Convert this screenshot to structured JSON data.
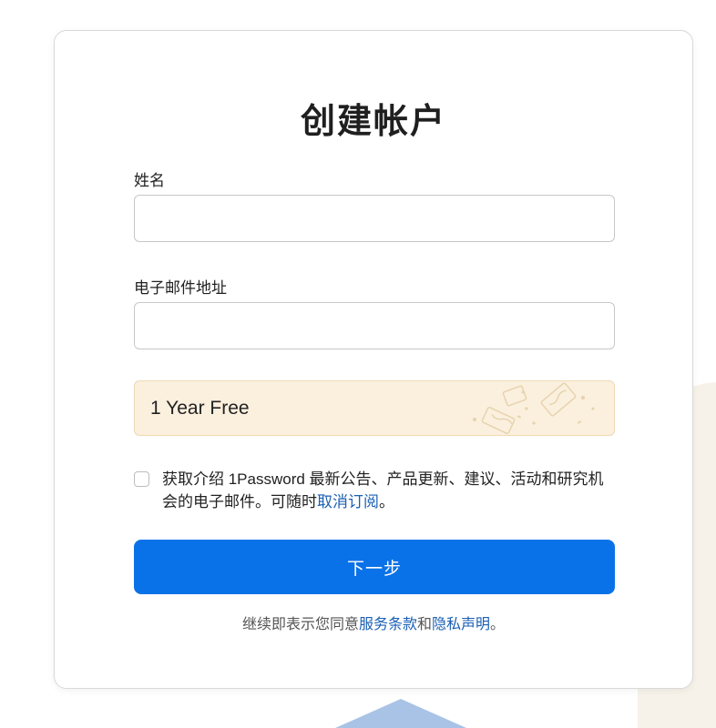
{
  "form": {
    "title": "创建帐户",
    "name_label": "姓名",
    "name_value": "",
    "email_label": "电子邮件地址",
    "email_value": ""
  },
  "promo": {
    "text": "1 Year Free",
    "colors": {
      "background": "#fbf0de",
      "border": "#efd9b4"
    }
  },
  "consent": {
    "checked": false,
    "text": "获取介绍 1Password 最新公告、产品更新、建议、活动和研究机会的电子邮件。可随时",
    "unsubscribe_link": "取消订阅",
    "end": "。"
  },
  "next_button": {
    "label": "下一步",
    "color": "#0a72e8"
  },
  "terms": {
    "prefix": "继续即表示您同意",
    "terms_link": "服务条款",
    "and": "和",
    "privacy_link": "隐私声明",
    "end": "。",
    "link_color": "#1a5fb4"
  }
}
